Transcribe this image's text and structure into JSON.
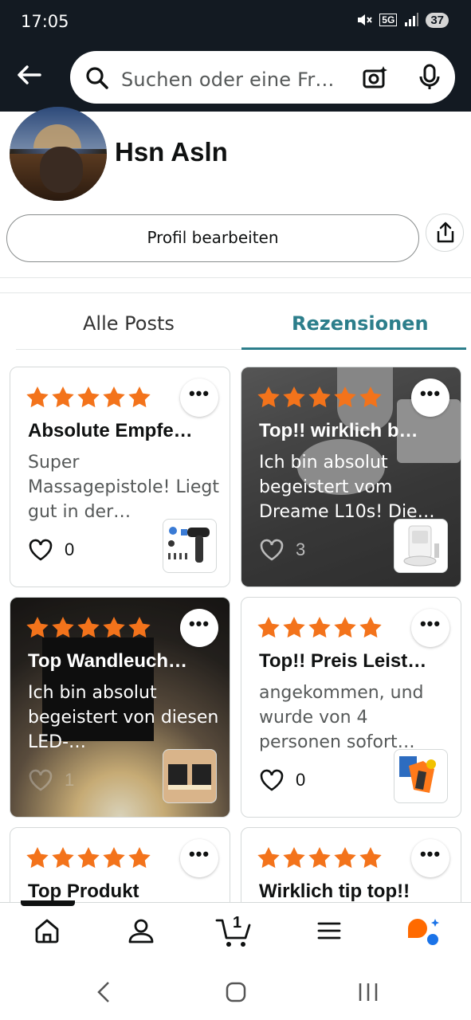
{
  "status": {
    "time": "17:05",
    "battery": "37",
    "network": "5G"
  },
  "search": {
    "placeholder": "Suchen oder eine Fr…"
  },
  "profile": {
    "name": "Hsn Asln",
    "edit_label": "Profil bearbeiten"
  },
  "tabs": [
    {
      "label": "Alle Posts",
      "active": false
    },
    {
      "label": "Rezensionen",
      "active": true
    }
  ],
  "cards": [
    {
      "title": "Absolute Empfe…",
      "body": "Super Massagepistole! Liegt gut in der…",
      "likes": "0",
      "stars": 5,
      "thumb": "massage-gun-icon"
    },
    {
      "title": "Top!! wirklich b…",
      "body": "Ich bin absolut begeistert vom Dreame L10s! Die…",
      "likes": "3",
      "stars": 5,
      "thumb": "robot-vacuum-icon"
    },
    {
      "title": "Top Wandleuch…",
      "body": "Ich bin absolut begeistert von diesen LED-…",
      "likes": "1",
      "stars": 5,
      "thumb": "wall-lamp-icon"
    },
    {
      "title": "Top!! Preis Leist…",
      "body": "angekommen, und wurde von 4 personen sofort…",
      "likes": "0",
      "stars": 5,
      "thumb": "work-gloves-icon"
    },
    {
      "title": "Top Produkt",
      "stars": 5
    },
    {
      "title": "Wirklich tip top!!",
      "stars": 5
    }
  ],
  "nav": {
    "cart_count": "1"
  },
  "colors": {
    "header": "#131a22",
    "accent": "#2c7e8b",
    "star": "#f3731b",
    "brand": "#ff6a00"
  }
}
